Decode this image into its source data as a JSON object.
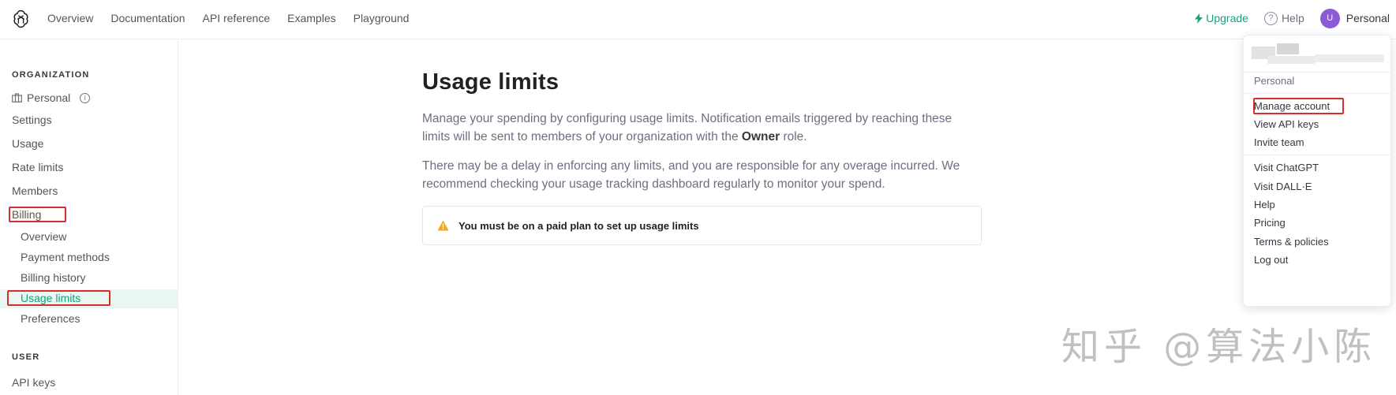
{
  "nav": {
    "links": [
      "Overview",
      "Documentation",
      "API reference",
      "Examples",
      "Playground"
    ],
    "upgrade": "Upgrade",
    "help": "Help",
    "help_icon_glyph": "?",
    "avatar_initial": "U",
    "account": "Personal"
  },
  "sidebar": {
    "org_label": "ORGANIZATION",
    "org_name": "Personal",
    "info_glyph": "i",
    "items": [
      "Settings",
      "Usage",
      "Rate limits",
      "Members",
      "Billing"
    ],
    "billing_sub": [
      "Overview",
      "Payment methods",
      "Billing history",
      "Usage limits",
      "Preferences"
    ],
    "active_item": "Usage limits",
    "user_label": "USER",
    "user_items": [
      "API keys"
    ]
  },
  "main": {
    "title": "Usage limits",
    "para1_before": "Manage your spending by configuring usage limits. Notification emails triggered by reaching these limits will be sent to members of your organization with the ",
    "para1_bold": "Owner",
    "para1_after": " role.",
    "para2": "There may be a delay in enforcing any limits, and you are responsible for any overage incurred. We recommend checking your usage tracking dashboard regularly to monitor your spend.",
    "notice": "You must be on a paid plan to set up usage limits",
    "notice_icon": "warning-icon"
  },
  "dropdown": {
    "org": "Personal",
    "group1": [
      "Manage account",
      "View API keys",
      "Invite team"
    ],
    "group2": [
      "Visit ChatGPT",
      "Visit DALL·E",
      "Help",
      "Pricing",
      "Terms & policies",
      "Log out"
    ]
  },
  "watermark": "知乎 @算法小陈",
  "colors": {
    "accent": "#10a37f",
    "highlight_box": "#d92c2c",
    "warning": "#f0a626",
    "avatar": "#8e5bd6"
  }
}
